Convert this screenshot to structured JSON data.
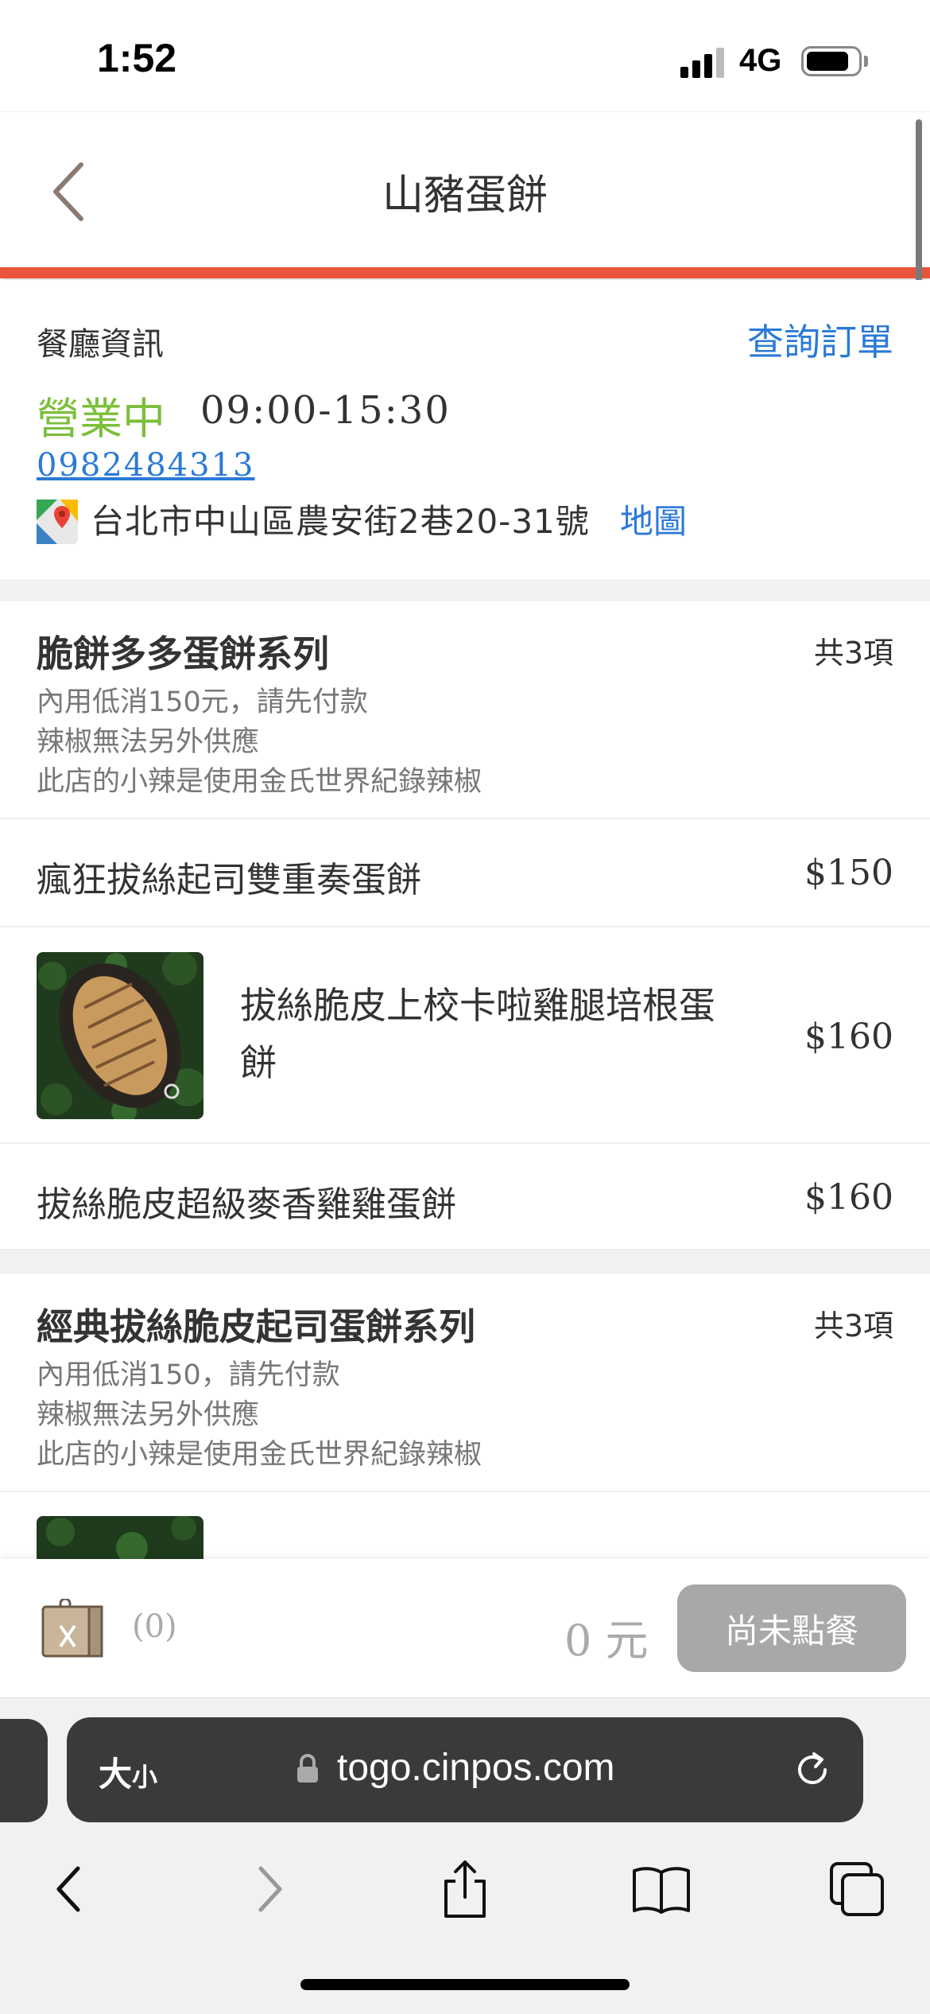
{
  "status_bar": {
    "time": "1:52",
    "network": "4G"
  },
  "header": {
    "title": "山豬蛋餅"
  },
  "restaurant": {
    "info_label": "餐廳資訊",
    "order_query": "查詢訂單",
    "open_status": "營業中",
    "hours": "09:00-15:30",
    "phone": "0982484313",
    "address": "台北市中山區農安街2巷20-31號",
    "map_link": "地圖"
  },
  "categories": [
    {
      "title": "脆餅多多蛋餅系列",
      "count": "共3項",
      "notes": [
        "內用低消150元，請先付款",
        "辣椒無法另外供應",
        "此店的小辣是使用金氏世界紀錄辣椒"
      ],
      "items": [
        {
          "name": "瘋狂拔絲起司雙重奏蛋餅",
          "price": "$150"
        },
        {
          "name": "拔絲脆皮上校卡啦雞腿培根蛋餅",
          "price": "$160"
        },
        {
          "name": "拔絲脆皮超級麥香雞雞蛋餅",
          "price": "$160"
        }
      ]
    },
    {
      "title": "經典拔絲脆皮起司蛋餅系列",
      "count": "共3項",
      "notes": [
        "內用低消150，請先付款",
        "辣椒無法另外供應",
        "此店的小辣是使用金氏世界紀錄辣椒"
      ]
    }
  ],
  "cart": {
    "count": "(0)",
    "total": "0 元",
    "button": "尚未點餐"
  },
  "browser": {
    "size_label_big": "大",
    "size_label_small": "小",
    "url": "togo.cinpos.com"
  },
  "icons": {
    "back": "chevron-left-icon",
    "map": "google-maps-icon",
    "cart": "bag-icon",
    "lock": "lock-icon",
    "reload": "reload-icon",
    "share": "share-icon",
    "bookmarks": "book-icon",
    "tabs": "tabs-icon"
  },
  "colors": {
    "accent": "#e8553a",
    "link": "#2a7ad8",
    "open": "#7bbf3a"
  }
}
